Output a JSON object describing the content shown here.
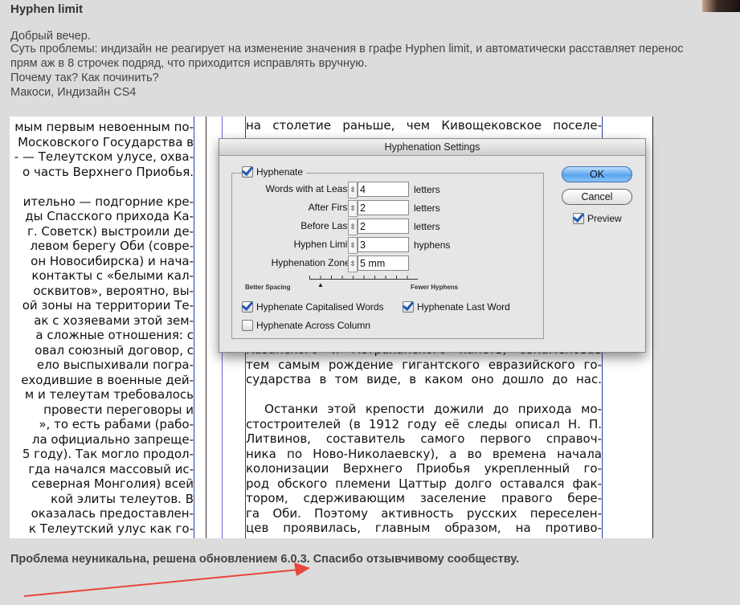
{
  "post": {
    "title": "Hyphen limit",
    "lines": [
      "Добрый вечер.",
      "Суть проблемы: индизайн не реагирует на изменение значения в графе Hyphen limit, и автоматически расставляет перенос",
      "прям аж в 8 строчек подряд, что приходится исправлять вручную.",
      "Почему так? Как починить?",
      "Макоси, Индизайн CS4"
    ],
    "footer": "Проблема неуникальна, решена обновлением 6.0.3. Спасибо отзывчивому сообществу."
  },
  "document": {
    "left_column": [
      "мым первым невоенным по-",
      "Московского Государства в",
      "- — Телеутском улусе, охва-",
      "о часть Верхнего Приобья.",
      "",
      "ительно — подгорние кре-",
      "ды Спасского прихода Ка-",
      "г. Советск) выстроили де-",
      "левом берегу Оби (совре-",
      "он Новосибирска) и нача-",
      "контакты с «белыми кал-",
      "осквитов», вероятно, вы-",
      "ой зоны на территории Те-",
      "ак с хозяевами этой зем-",
      "а сложные отношения: с",
      "овал союзный договор, с",
      "ело выспыхивали погра-",
      "еходившие в военные дей-",
      "м и телеутам требовалось",
      "провести переговоры и",
      "», то есть рабами (рабо-",
      "ла официально запреще-",
      "5 году). Так могло продол-",
      "гда начался массовый ис-",
      "северная Монголия) всей",
      "кой элиты телеутов. В",
      "оказалась предоставлен-",
      "к Телеутский улус как го-"
    ],
    "right_top": "на столетие раньше, чем Кивощековское поселе-",
    "right_bottom": [
      "Казанского и Астраханского ханств, ознаменовав",
      "тем самым рождение гигантского евразийского го-",
      "сударства в том виде, в каком оно дошло до нас.",
      "",
      "  Останки этой крепости дожили до прихода мо-",
      "стостроителей (в 1912 году её следы описал Н. П.",
      "Литвинов, составитель самого первого справоч-",
      "ника по Ново-Николаевску), а во времена начала",
      "колонизации Верхнего Приобья укрепленный го-",
      "род обского племени Цаттыр долго оставался фак-",
      "тором, сдерживающим заселение правого бере-",
      "га Оби. Поэтому активность русских переселен-",
      "цев проявилась, главным образом, на противо-"
    ]
  },
  "dialog": {
    "title": "Hyphenation Settings",
    "hyphenate": {
      "label": "Hyphenate",
      "checked": true
    },
    "rows": [
      {
        "label": "Words with at Least:",
        "value": "4",
        "unit": "letters"
      },
      {
        "label": "After First:",
        "value": "2",
        "unit": "letters"
      },
      {
        "label": "Before Last:",
        "value": "2",
        "unit": "letters"
      },
      {
        "label": "Hyphen Limit:",
        "value": "3",
        "unit": "hyphens"
      },
      {
        "label": "Hyphenation Zone:",
        "value": "5 mm",
        "unit": ""
      }
    ],
    "slider": {
      "left_label": "Better Spacing",
      "right_label": "Fewer Hyphens",
      "position_fraction": 0.1
    },
    "capitalised": {
      "label": "Hyphenate Capitalised Words",
      "checked": true
    },
    "last_word": {
      "label": "Hyphenate Last Word",
      "checked": true
    },
    "across_column": {
      "label": "Hyphenate Across Column",
      "checked": false
    },
    "ok_label": "OK",
    "cancel_label": "Cancel",
    "preview": {
      "label": "Preview",
      "checked": true
    }
  },
  "colors": {
    "background": "#dcdcdc",
    "arrow": "#e8453c",
    "ok_button": "#5aa4ee"
  }
}
